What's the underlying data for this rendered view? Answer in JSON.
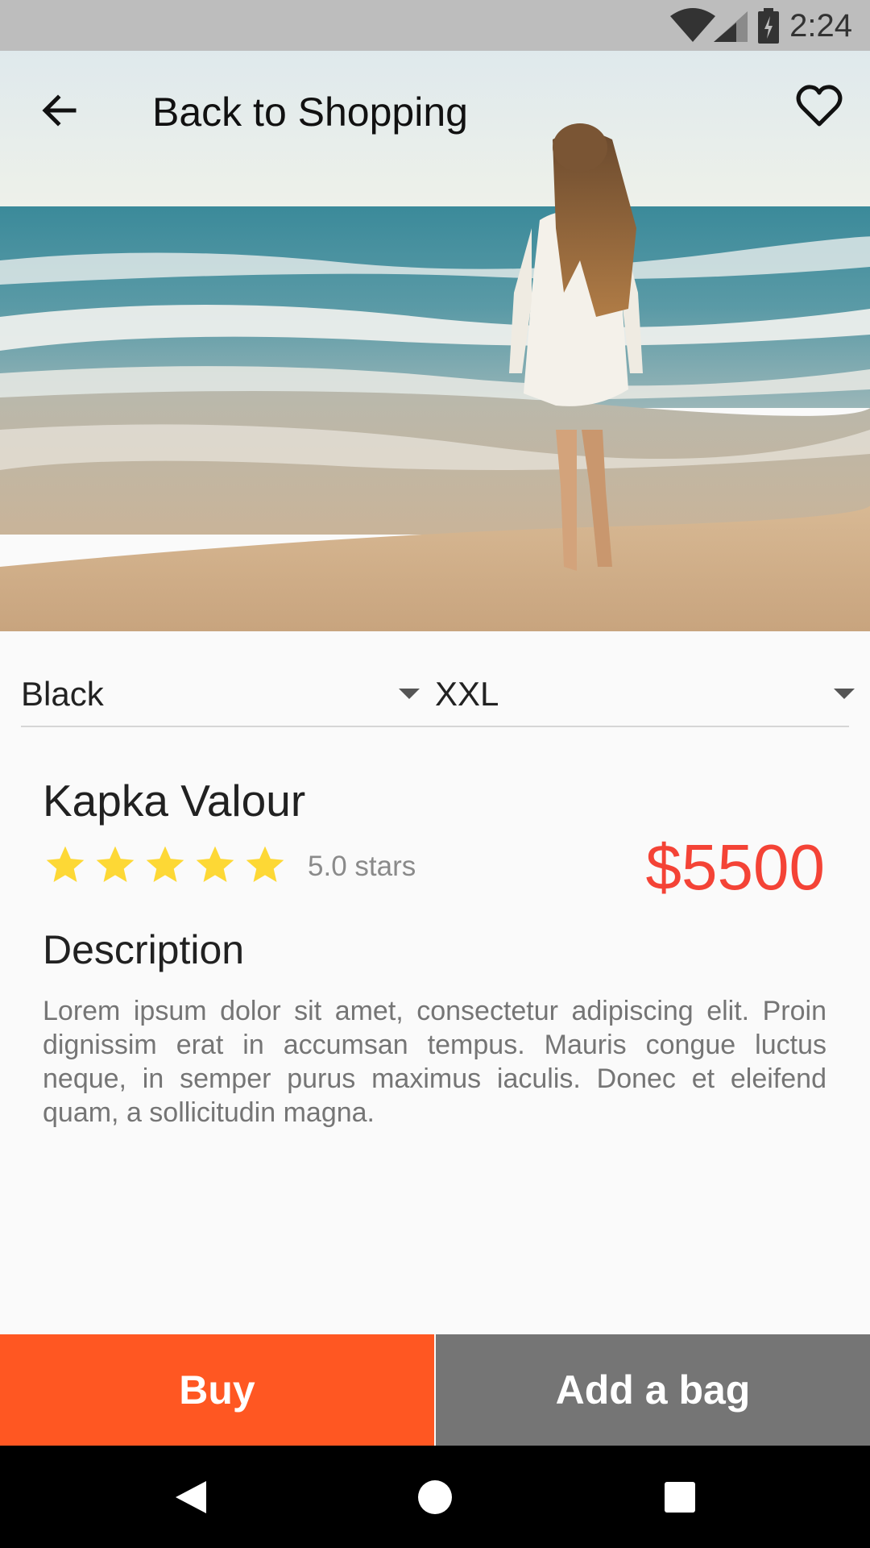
{
  "status_bar": {
    "time": "2:24",
    "icons": [
      "wifi-icon",
      "signal-icon",
      "battery-charging-icon"
    ]
  },
  "toolbar": {
    "title": "Back to Shopping",
    "back_icon": "arrow-back-icon",
    "favorite_icon": "heart-outline-icon"
  },
  "selectors": {
    "color": {
      "value": "Black"
    },
    "size": {
      "value": "XXL"
    }
  },
  "product": {
    "name": "Kapka Valour",
    "rating": 5.0,
    "rating_max": 5,
    "rating_text": "5.0 stars",
    "price": "$5500",
    "description_heading": "Description",
    "description": "Lorem ipsum dolor sit amet, consectetur adipiscing elit. Proin dignissim erat in accumsan tempus. Mauris congue luctus neque, in semper purus maximus iaculis. Donec et eleifend quam, a sollicitudin magna."
  },
  "actions": {
    "buy_label": "Buy",
    "bag_label": "Add a bag"
  },
  "nav": {
    "icons": [
      "back-triangle-icon",
      "home-circle-icon",
      "recents-square-icon"
    ]
  },
  "colors": {
    "accent": "#ff5722",
    "price": "#f44336",
    "star": "#fdd835",
    "secondary_button": "#757575"
  }
}
